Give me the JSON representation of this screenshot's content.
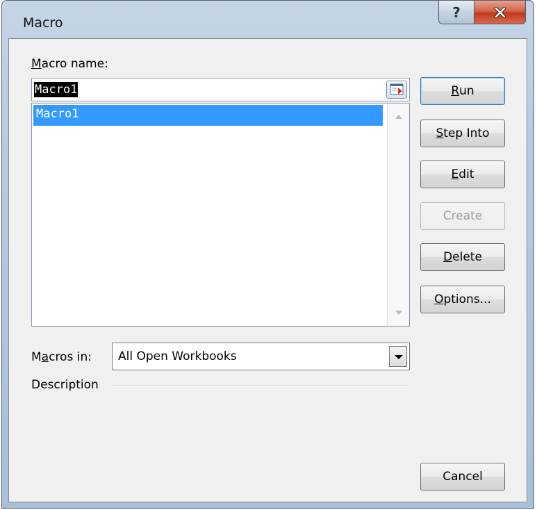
{
  "window": {
    "title": "Macro"
  },
  "titlebar": {
    "help_glyph": "?"
  },
  "macro_name": {
    "label_access_key": "M",
    "label_rest": "acro name:",
    "value": "Macro1"
  },
  "macro_list": {
    "items": [
      "Macro1"
    ],
    "selected_index": 0
  },
  "buttons": {
    "run": {
      "accel": "R",
      "rest": "un"
    },
    "step_into": {
      "accel": "S",
      "rest": "tep Into"
    },
    "edit": {
      "accel": "E",
      "rest": "dit"
    },
    "create": {
      "label": "Create"
    },
    "delete": {
      "accel": "D",
      "rest": "elete"
    },
    "options": {
      "accel": "O",
      "rest": "ptions..."
    },
    "cancel": {
      "label": "Cancel"
    }
  },
  "macros_in": {
    "label_pre": "M",
    "label_accel": "a",
    "label_post": "cros in:",
    "selected": "All Open Workbooks"
  },
  "description": {
    "label": "Description"
  },
  "colors": {
    "selection": "#3399ff",
    "close_button": "#c75a3f",
    "disabled_text": "#a0a0a0"
  }
}
